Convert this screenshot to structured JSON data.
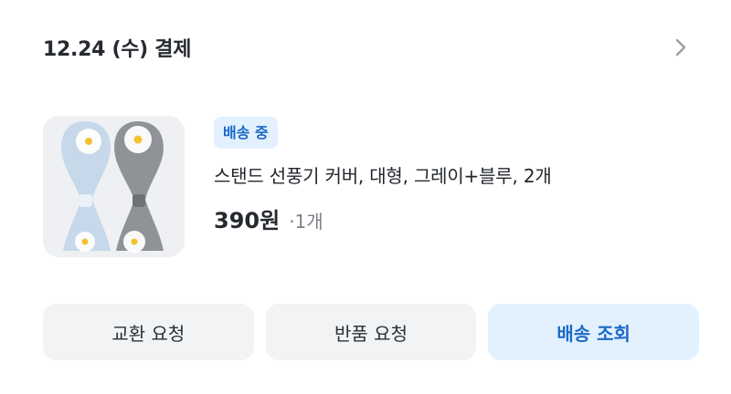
{
  "order": {
    "date_label": "12.24 (수) 결제"
  },
  "product": {
    "status": "배송 중",
    "name": "스탠드 선풍기 커버, 대형, 그레이+블루, 2개",
    "price": "390원",
    "quantity": "·1개"
  },
  "actions": {
    "exchange": "교환 요청",
    "return": "반품 요청",
    "tracking": "배송 조회"
  },
  "colors": {
    "accent": "#1c69c6",
    "accent_bg": "#e3f1ff",
    "button_bg": "#f1f3f5"
  },
  "icons": {
    "detail": "chevron-right-icon",
    "thumbnail": "fan-cover-product-image"
  }
}
